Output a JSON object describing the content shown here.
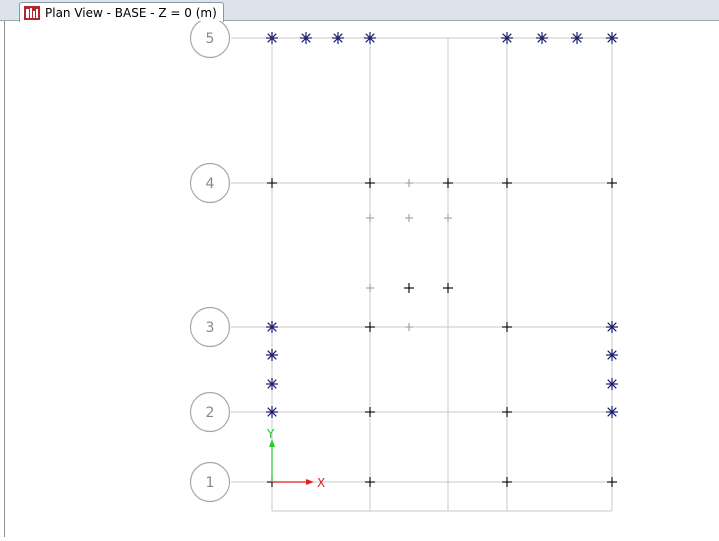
{
  "window": {
    "tab_title": "Plan View - BASE - Z = 0 (m)",
    "tab_icon": "etabs-app-icon"
  },
  "grid": {
    "row_bubbles": [
      "5",
      "4",
      "3",
      "2",
      "1"
    ]
  },
  "axes": {
    "y_label": "Y",
    "x_label": "X",
    "y_color": "#22cc22",
    "x_color": "#dd2222"
  },
  "colors": {
    "gridline": "#c8c8c8",
    "bubble": "#a8a8a8",
    "support_marker": "#1c1c6e",
    "joint_marker": "#000000",
    "faint_joint_marker": "#a0a0a0"
  },
  "markers": {
    "support_symbol": "asterisk",
    "joint_symbol": "plus"
  }
}
